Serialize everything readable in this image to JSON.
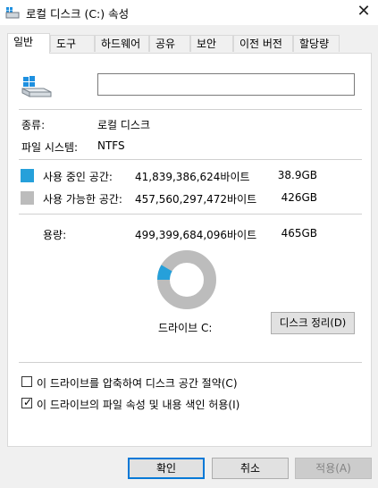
{
  "window": {
    "title": "로컬 디스크 (C:) 속성",
    "close_glyph": "✕"
  },
  "tabs": [
    {
      "label": "일반"
    },
    {
      "label": "도구"
    },
    {
      "label": "하드웨어"
    },
    {
      "label": "공유"
    },
    {
      "label": "보안"
    },
    {
      "label": "이전 버전"
    },
    {
      "label": "할당량"
    }
  ],
  "general": {
    "drive_name_value": "",
    "type_label": "종류:",
    "type_value": "로컬 디스크",
    "fs_label": "파일 시스템:",
    "fs_value": "NTFS",
    "used_label": "사용 중인 공간:",
    "used_bytes": "41,839,386,624바이트",
    "used_size": "38.9GB",
    "free_label": "사용 가능한 공간:",
    "free_bytes": "457,560,297,472바이트",
    "free_size": "426GB",
    "capacity_label": "용량:",
    "capacity_bytes": "499,399,684,096바이트",
    "capacity_size": "465GB",
    "drive_label": "드라이브 C:",
    "cleanup_button": "디스크 정리(D)",
    "used_fraction": 0.0838,
    "colors": {
      "used": "#26a0da",
      "free": "#bcbcbc"
    },
    "compress_label": "이 드라이브를 압축하여 디스크 공간 절약(C)",
    "compress_checked": false,
    "index_label": "이 드라이브의 파일 속성 및 내용 색인 허용(I)",
    "index_checked": true
  },
  "buttons": {
    "ok": "확인",
    "cancel": "취소",
    "apply": "적용(A)"
  }
}
